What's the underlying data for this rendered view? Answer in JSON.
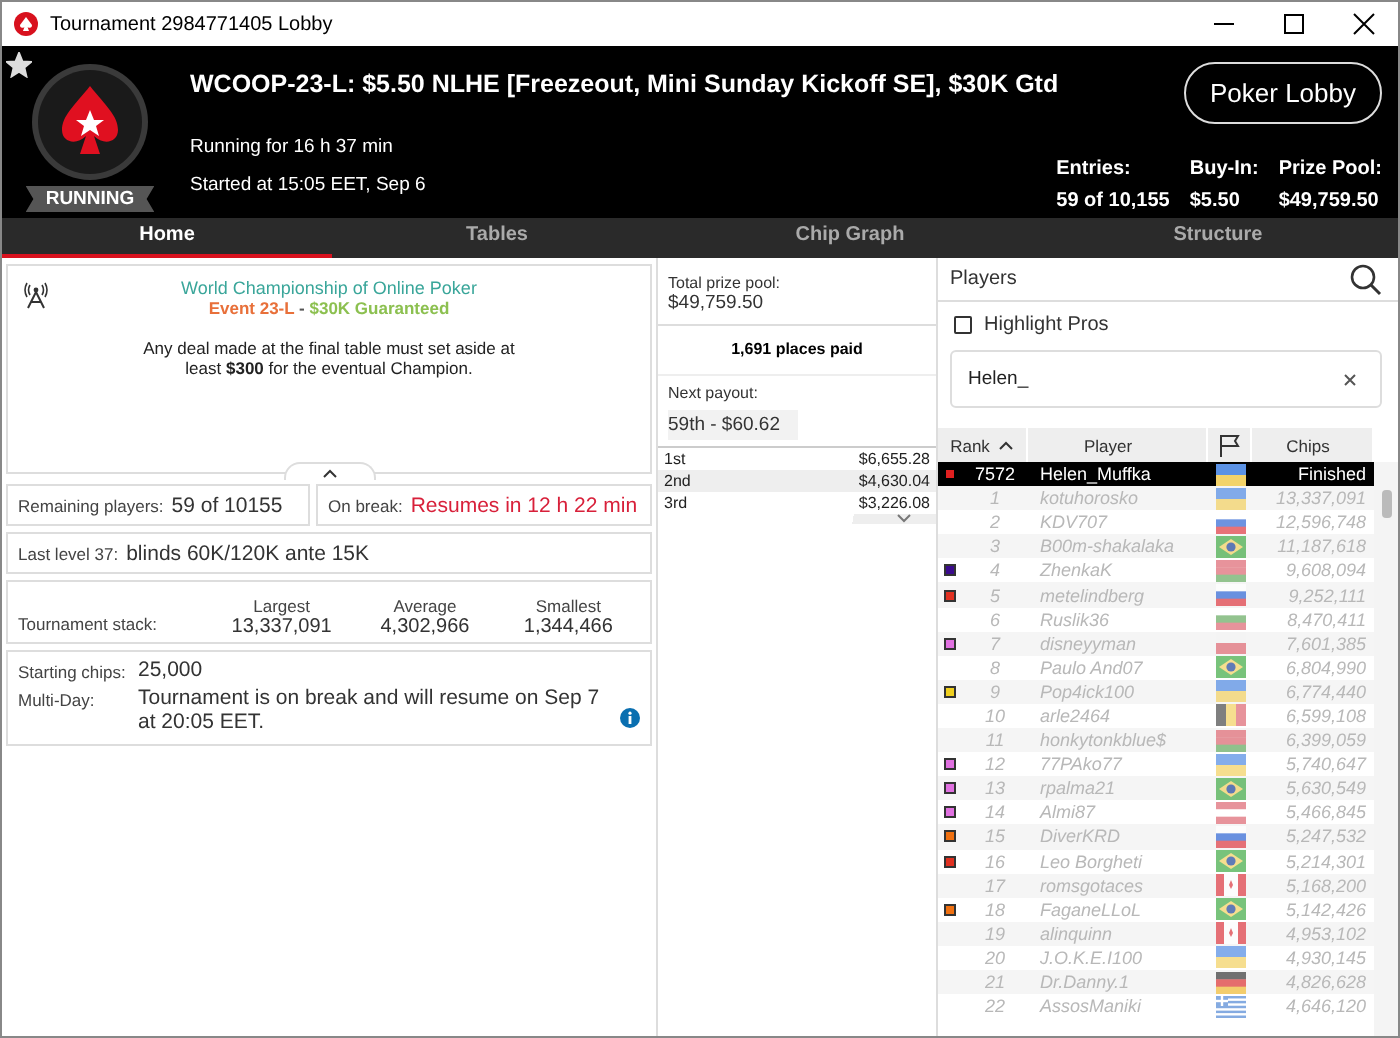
{
  "window": {
    "title": "Tournament 2984771405 Lobby"
  },
  "header": {
    "favorite": true,
    "status": "RUNNING",
    "title": "WCOOP-23-L: $5.50 NLHE [Freezeout, Mini Sunday Kickoff SE], $30K Gtd",
    "running_for": "Running for 16 h 37 min",
    "started": "Started at 15:05 EET, Sep 6",
    "lobby_button": "Poker Lobby",
    "stats": [
      {
        "label": "Entries:",
        "value": "59 of 10,155"
      },
      {
        "label": "Buy-In:",
        "value": "$5.50"
      },
      {
        "label": "Prize Pool:",
        "value": "$49,759.50"
      }
    ]
  },
  "tabs": [
    {
      "label": "Home",
      "selected": true
    },
    {
      "label": "Tables",
      "selected": false
    },
    {
      "label": "Chip Graph",
      "selected": false
    },
    {
      "label": "Structure",
      "selected": false
    }
  ],
  "info": {
    "heading": "World Championship of Online Poker",
    "event": "Event 23-L",
    "separator": " - ",
    "guarantee": "$30K Guaranteed",
    "note": "Any deal made at the final table must set aside at least **$300** for the eventual Champion."
  },
  "remaining": {
    "label": "Remaining players:",
    "value": "59 of 10155"
  },
  "break": {
    "label": "On break:",
    "value": "Resumes in 12 h 22 min"
  },
  "level": {
    "label": "Last level 37:",
    "value": "blinds 60K/120K ante 15K"
  },
  "stack": {
    "label": "Tournament stack:",
    "columns": [
      {
        "label": "Largest",
        "value": "13,337,091"
      },
      {
        "label": "Average",
        "value": "4,302,966"
      },
      {
        "label": "Smallest",
        "value": "1,344,466"
      }
    ]
  },
  "details": [
    {
      "label": "Starting chips:",
      "value": "25,000",
      "info": false
    },
    {
      "label": "Multi-Day:",
      "value": "Tournament is on break and will resume on Sep 7 at 20:05 EET.",
      "info": true
    }
  ],
  "prizes": {
    "total_label": "Total prize pool:",
    "total": "$49,759.50",
    "places_paid": "1,691 places paid",
    "next_label": "Next payout:",
    "next": "59th - $60.62",
    "payouts": [
      {
        "place": "1st",
        "amount": "$6,655.28"
      },
      {
        "place": "2nd",
        "amount": "$4,630.04"
      },
      {
        "place": "3rd",
        "amount": "$3,226.08"
      }
    ]
  },
  "players": {
    "title": "Players",
    "highlight_pros": {
      "label": "Highlight Pros",
      "checked": false
    },
    "search": "Helen_",
    "columns": [
      "Rank",
      "Player",
      "Chips"
    ],
    "rows": [
      {
        "rank": "7572",
        "player": "Helen_Muffka",
        "chips": "Finished",
        "kind": "ua",
        "color": "#e02020",
        "selected": true
      },
      {
        "rank": "1",
        "player": "kotuhorosko",
        "chips": "13,337,091",
        "kind": "ua",
        "selected": false
      },
      {
        "rank": "2",
        "player": "KDV707",
        "chips": "12,596,748",
        "kind": "ru",
        "selected": false
      },
      {
        "rank": "3",
        "player": "B00m-shakalaka",
        "chips": "11,187,618",
        "kind": "br",
        "selected": false
      },
      {
        "rank": "4",
        "player": "ZhenkaK",
        "chips": "9,608,094",
        "kind": "by",
        "color": "#3a0a8c",
        "selected": false
      },
      {
        "rank": "5",
        "player": "metelindberg",
        "chips": "9,252,111",
        "kind": "ru",
        "color": "#e03020",
        "selected": false
      },
      {
        "rank": "6",
        "player": "Ruslik36",
        "chips": "8,470,411",
        "kind": "bg",
        "selected": false
      },
      {
        "rank": "7",
        "player": "disneyyman",
        "chips": "7,601,385",
        "kind": "pl",
        "color": "#e070e0",
        "selected": false
      },
      {
        "rank": "8",
        "player": "Paulo And07",
        "chips": "6,804,990",
        "kind": "br",
        "selected": false
      },
      {
        "rank": "9",
        "player": "Pop4ick100",
        "chips": "6,774,440",
        "kind": "ua",
        "color": "#f0d020",
        "selected": false
      },
      {
        "rank": "10",
        "player": "arle2464",
        "chips": "6,599,108",
        "kind": "be",
        "selected": false
      },
      {
        "rank": "11",
        "player": "honkytonkblue$",
        "chips": "6,399,059",
        "kind": "by",
        "selected": false
      },
      {
        "rank": "12",
        "player": "77PAko77",
        "chips": "5,740,647",
        "kind": "ua",
        "color": "#e070e0",
        "selected": false
      },
      {
        "rank": "13",
        "player": "rpalma21",
        "chips": "5,630,549",
        "kind": "br",
        "color": "#e070e0",
        "selected": false
      },
      {
        "rank": "14",
        "player": "Almi87",
        "chips": "5,466,845",
        "kind": "at",
        "color": "#e070e0",
        "selected": false
      },
      {
        "rank": "15",
        "player": "DiverKRD",
        "chips": "5,247,532",
        "kind": "ru",
        "color": "#f07010",
        "selected": false
      },
      {
        "rank": "16",
        "player": "Leo Borgheti",
        "chips": "5,214,301",
        "kind": "br",
        "color": "#e03020",
        "selected": false
      },
      {
        "rank": "17",
        "player": "romsgotaces",
        "chips": "5,168,200",
        "kind": "ca",
        "selected": false
      },
      {
        "rank": "18",
        "player": "FaganeLLoL",
        "chips": "5,142,426",
        "kind": "br",
        "color": "#f07010",
        "selected": false
      },
      {
        "rank": "19",
        "player": "alinquinn",
        "chips": "4,953,102",
        "kind": "ca",
        "selected": false
      },
      {
        "rank": "20",
        "player": "J.O.K.E.I100",
        "chips": "4,930,145",
        "kind": "ua",
        "selected": false
      },
      {
        "rank": "21",
        "player": "Dr.Danny.1",
        "chips": "4,826,628",
        "kind": "de",
        "selected": false
      },
      {
        "rank": "22",
        "player": "AssosManiki",
        "chips": "4,646,120",
        "kind": "gr",
        "selected": false
      }
    ]
  }
}
